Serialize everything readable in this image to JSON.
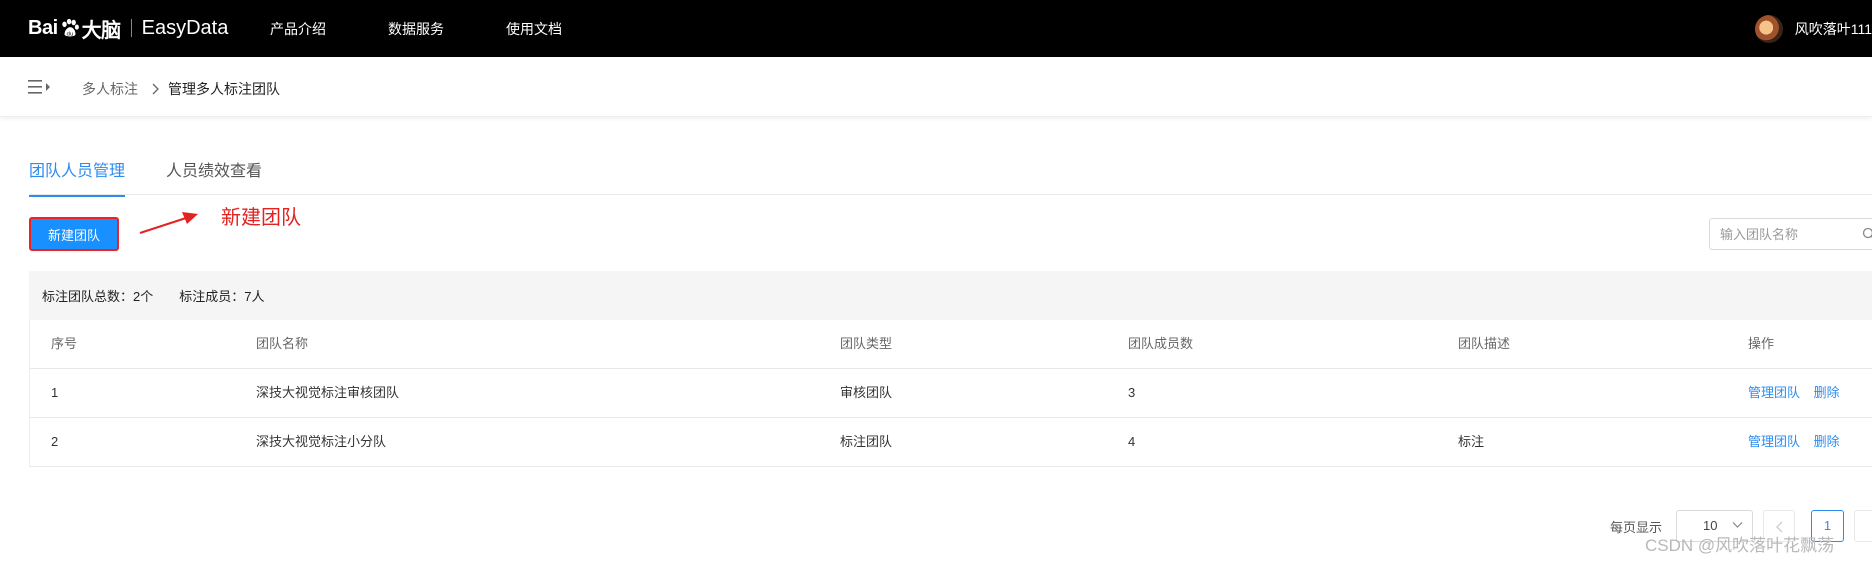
{
  "header": {
    "logo_brand_left": "Bai",
    "logo_brand_right": "大脑",
    "product": "EasyData",
    "nav": [
      {
        "label": "产品介绍"
      },
      {
        "label": "数据服务"
      },
      {
        "label": "使用文档"
      }
    ],
    "user_name": "风吹落叶111"
  },
  "breadcrumb": {
    "items": [
      {
        "label": "多人标注"
      },
      {
        "label": "管理多人标注团队"
      }
    ]
  },
  "tabs": [
    {
      "label": "团队人员管理",
      "active": true
    },
    {
      "label": "人员绩效查看",
      "active": false
    }
  ],
  "toolbar": {
    "new_team_label": "新建团队",
    "annotation_text": "新建团队",
    "search_placeholder": "输入团队名称"
  },
  "summary": {
    "teams_text": "标注团队总数：2个",
    "members_text": "标注成员：7人"
  },
  "table": {
    "columns": [
      "序号",
      "团队名称",
      "团队类型",
      "团队成员数",
      "团队描述",
      "操作"
    ],
    "rows": [
      {
        "index": "1",
        "name": "深技大视觉标注审核团队",
        "type": "审核团队",
        "members": "3",
        "desc": "",
        "ops": [
          "管理团队",
          "删除"
        ]
      },
      {
        "index": "2",
        "name": "深技大视觉标注小分队",
        "type": "标注团队",
        "members": "4",
        "desc": "标注",
        "ops": [
          "管理团队",
          "删除"
        ]
      }
    ]
  },
  "pagination": {
    "per_page_label": "每页显示",
    "page_size": "10",
    "current_page": "1"
  },
  "watermark": "CSDN @风吹落叶花飘荡",
  "colors": {
    "accent": "#2d8cf0",
    "primary_button": "#1890ff",
    "annotation": "#e32222",
    "topbar": "#000000"
  }
}
